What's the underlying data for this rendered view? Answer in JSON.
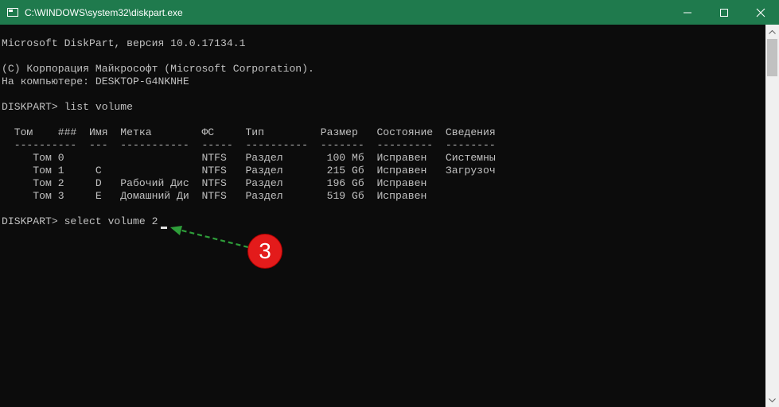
{
  "window": {
    "title": "C:\\WINDOWS\\system32\\diskpart.exe",
    "icons": [
      "console-app-icon",
      "minimize-icon",
      "maximize-icon",
      "close-icon"
    ],
    "titlebar_color": "#1f7a4d"
  },
  "console": {
    "lines": [
      "Microsoft DiskPart, версия 10.0.17134.1",
      "",
      "(C) Корпорация Майкрософт (Microsoft Corporation).",
      "На компьютере: DESKTOP-G4NKNHE",
      "",
      "DISKPART> list volume",
      "",
      "  Том    ###  Имя  Метка        ФС     Тип         Размер   Состояние  Сведения",
      "  ----------  ---  -----------  -----  ----------  -------  ---------  --------",
      "     Том 0                      NTFS   Раздел       100 Мб  Исправен   Системны",
      "     Том 1     C                NTFS   Раздел       215 Gб  Исправен   Загрузоч",
      "     Том 2     D   Рабочий Дис  NTFS   Раздел       196 Gб  Исправен",
      "     Том 3     E   Домашний Ди  NTFS   Раздел       519 Gб  Исправен",
      "",
      "DISKPART> select volume 2"
    ],
    "text_color": "#c0c0c0",
    "background": "#0c0c0c"
  },
  "annotation": {
    "step_number": "3",
    "badge_color": "#e31b1b",
    "arrow_color": "#2e9e3a"
  }
}
